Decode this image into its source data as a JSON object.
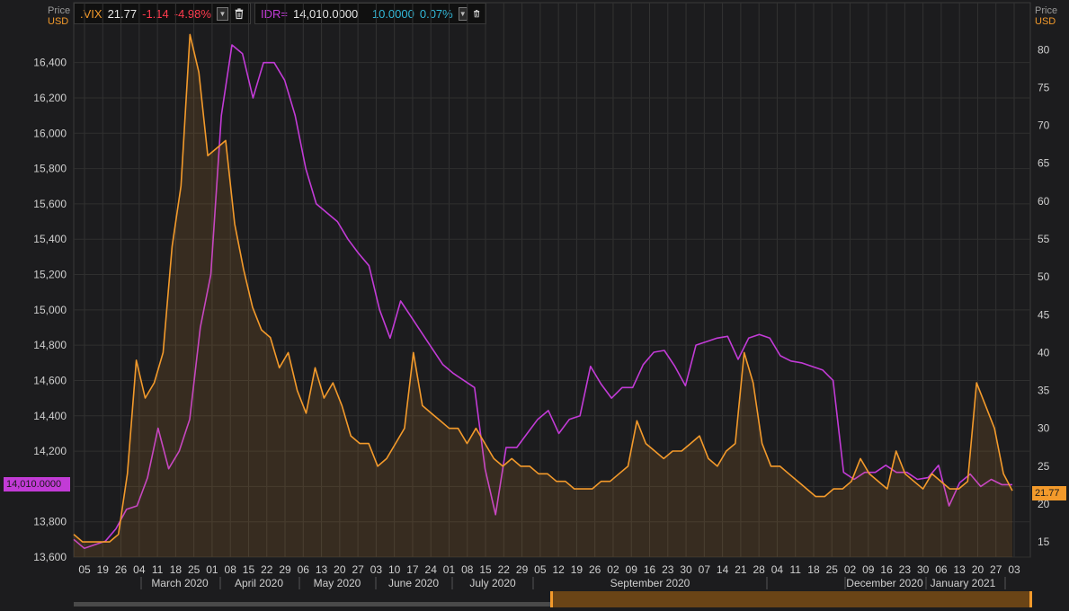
{
  "left_axis": {
    "label_top": "Price",
    "label_bottom": "USD"
  },
  "right_axis": {
    "label_top": "Price",
    "label_bottom": "USD"
  },
  "legend": [
    {
      "symbol": ".VIX",
      "last": "21.77",
      "change": "-1.14",
      "change_pct": "-4.98%"
    },
    {
      "symbol": "IDR=",
      "last": "14,010.0000",
      "change": "10.0000",
      "change_pct": "0.07%"
    }
  ],
  "price_tags": {
    "left": "14,010.0000",
    "right": "21.77"
  },
  "colors": {
    "vix": "#f39a2b",
    "idr": "#c23bd6",
    "background": "#1c1c1e",
    "grid": "#3a3a3a"
  },
  "icons": [
    "chevron-down-icon",
    "trash-icon"
  ],
  "chart_data": {
    "type": "line",
    "title": "",
    "x_day_labels": [
      "05",
      "19",
      "26",
      "04",
      "11",
      "18",
      "25",
      "01",
      "08",
      "15",
      "22",
      "29",
      "06",
      "13",
      "20",
      "27",
      "03",
      "10",
      "17",
      "24",
      "01",
      "08",
      "15",
      "22",
      "29",
      "05",
      "12",
      "19",
      "26",
      "02",
      "09",
      "16",
      "23",
      "30",
      "07",
      "14",
      "21",
      "28",
      "04",
      "11",
      "18",
      "25",
      "02",
      "09",
      "16",
      "23",
      "30",
      "06",
      "13",
      "20",
      "27",
      "03"
    ],
    "x_month_labels": [
      "March 2020",
      "April 2020",
      "May 2020",
      "June 2020",
      "July 2020",
      "September 2020",
      "December 2020",
      "January 2021"
    ],
    "left_ylim": [
      13600,
      16500
    ],
    "left_ticks": [
      "13,600",
      "13,800",
      "14,000",
      "14,200",
      "14,400",
      "14,600",
      "14,800",
      "15,000",
      "15,200",
      "15,400",
      "15,600",
      "15,800",
      "16,000",
      "16,200",
      "16,400"
    ],
    "right_ylim": [
      13,
      83
    ],
    "right_ticks": [
      "15",
      "20",
      "25",
      "30",
      "35",
      "40",
      "45",
      "50",
      "55",
      "60",
      "65",
      "70",
      "75",
      "80"
    ],
    "grid": true,
    "series": [
      {
        "name": "IDR=",
        "axis": "left",
        "values": [
          13700,
          13650,
          13670,
          13690,
          13760,
          13870,
          13890,
          14050,
          14330,
          14100,
          14200,
          14380,
          14900,
          15200,
          16100,
          16500,
          16450,
          16200,
          16400,
          16400,
          16300,
          16100,
          15800,
          15600,
          15550,
          15500,
          15400,
          15320,
          15250,
          15000,
          14840,
          15050,
          14960,
          14870,
          14780,
          14690,
          14640,
          14600,
          14560,
          14100,
          13840,
          14220,
          14220,
          14300,
          14380,
          14430,
          14300,
          14380,
          14400,
          14680,
          14580,
          14500,
          14560,
          14560,
          14690,
          14760,
          14770,
          14680,
          14570,
          14800,
          14820,
          14840,
          14850,
          14720,
          14840,
          14860,
          14840,
          14740,
          14710,
          14700,
          14680,
          14660,
          14600,
          14080,
          14040,
          14080,
          14080,
          14120,
          14080,
          14080,
          14040,
          14050,
          14120,
          13890,
          14020,
          14070,
          14000,
          14040,
          14010,
          14010
        ]
      },
      {
        "name": ".VIX",
        "axis": "right",
        "values": [
          16,
          15,
          15,
          15,
          15,
          16,
          24,
          39,
          34,
          36,
          40,
          54,
          62,
          82,
          77,
          66,
          67,
          68,
          57,
          51,
          46,
          43,
          42,
          38,
          40,
          35,
          32,
          38,
          34,
          36,
          33,
          29,
          28,
          28,
          25,
          26,
          28,
          30,
          40,
          33,
          32,
          31,
          30,
          30,
          28,
          30,
          28,
          26,
          25,
          26,
          25,
          25,
          24,
          24,
          23,
          23,
          22,
          22,
          22,
          23,
          23,
          24,
          25,
          31,
          28,
          27,
          26,
          27,
          27,
          28,
          29,
          26,
          25,
          27,
          28,
          40,
          36,
          28,
          25,
          25,
          24,
          23,
          22,
          21,
          21,
          22,
          22,
          23,
          26,
          24,
          23,
          22,
          27,
          24,
          23,
          22,
          24,
          23,
          22,
          22,
          23,
          36,
          33,
          30,
          24,
          21.77
        ]
      }
    ]
  }
}
